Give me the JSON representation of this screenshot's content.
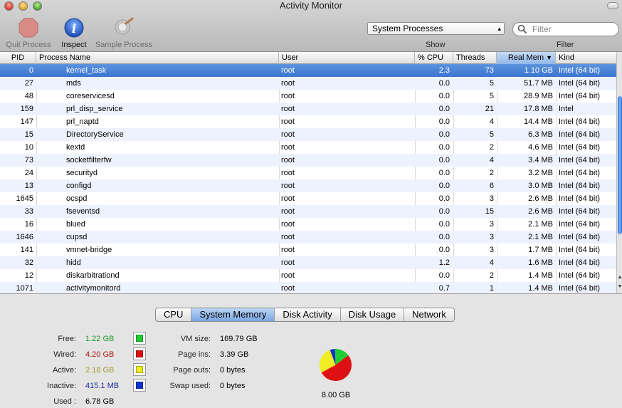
{
  "window": {
    "title": "Activity Monitor"
  },
  "toolbar": {
    "quit_label": "Quit Process",
    "inspect_label": "Inspect",
    "sample_label": "Sample Process",
    "show_label": "Show",
    "filter_label": "Filter",
    "show_value": "System Processes",
    "filter_placeholder": "Filter"
  },
  "table": {
    "columns": [
      "PID",
      "Process Name",
      "User",
      "% CPU",
      "Threads",
      "Real Mem",
      "Kind"
    ],
    "sorted_column": "Real Mem",
    "rows": [
      {
        "pid": "0",
        "name": "kernel_task",
        "user": "root",
        "cpu": "2.3",
        "threads": "73",
        "mem": "1.10 GB",
        "kind": "Intel (64 bit)"
      },
      {
        "pid": "27",
        "name": "mds",
        "user": "root",
        "cpu": "0.0",
        "threads": "5",
        "mem": "51.7 MB",
        "kind": "Intel (64 bit)"
      },
      {
        "pid": "48",
        "name": "coreservicesd",
        "user": "root",
        "cpu": "0.0",
        "threads": "5",
        "mem": "28.9 MB",
        "kind": "Intel (64 bit)"
      },
      {
        "pid": "159",
        "name": "prl_disp_service",
        "user": "root",
        "cpu": "0.0",
        "threads": "21",
        "mem": "17.8 MB",
        "kind": "Intel"
      },
      {
        "pid": "147",
        "name": "prl_naptd",
        "user": "root",
        "cpu": "0.0",
        "threads": "4",
        "mem": "14.4 MB",
        "kind": "Intel (64 bit)"
      },
      {
        "pid": "15",
        "name": "DirectoryService",
        "user": "root",
        "cpu": "0.0",
        "threads": "5",
        "mem": "6.3 MB",
        "kind": "Intel (64 bit)"
      },
      {
        "pid": "10",
        "name": "kextd",
        "user": "root",
        "cpu": "0.0",
        "threads": "2",
        "mem": "4.6 MB",
        "kind": "Intel (64 bit)"
      },
      {
        "pid": "73",
        "name": "socketfilterfw",
        "user": "root",
        "cpu": "0.0",
        "threads": "4",
        "mem": "3.4 MB",
        "kind": "Intel (64 bit)"
      },
      {
        "pid": "24",
        "name": "securityd",
        "user": "root",
        "cpu": "0.0",
        "threads": "2",
        "mem": "3.2 MB",
        "kind": "Intel (64 bit)"
      },
      {
        "pid": "13",
        "name": "configd",
        "user": "root",
        "cpu": "0.0",
        "threads": "6",
        "mem": "3.0 MB",
        "kind": "Intel (64 bit)"
      },
      {
        "pid": "1645",
        "name": "ocspd",
        "user": "root",
        "cpu": "0.0",
        "threads": "3",
        "mem": "2.6 MB",
        "kind": "Intel (64 bit)"
      },
      {
        "pid": "33",
        "name": "fseventsd",
        "user": "root",
        "cpu": "0.0",
        "threads": "15",
        "mem": "2.6 MB",
        "kind": "Intel (64 bit)"
      },
      {
        "pid": "16",
        "name": "blued",
        "user": "root",
        "cpu": "0.0",
        "threads": "3",
        "mem": "2.1 MB",
        "kind": "Intel (64 bit)"
      },
      {
        "pid": "1646",
        "name": "cupsd",
        "user": "root",
        "cpu": "0.0",
        "threads": "3",
        "mem": "2.1 MB",
        "kind": "Intel (64 bit)"
      },
      {
        "pid": "141",
        "name": "vmnet-bridge",
        "user": "root",
        "cpu": "0.0",
        "threads": "3",
        "mem": "1.7 MB",
        "kind": "Intel (64 bit)"
      },
      {
        "pid": "32",
        "name": "hidd",
        "user": "root",
        "cpu": "1.2",
        "threads": "4",
        "mem": "1.6 MB",
        "kind": "Intel (64 bit)"
      },
      {
        "pid": "12",
        "name": "diskarbitrationd",
        "user": "root",
        "cpu": "0.0",
        "threads": "2",
        "mem": "1.4 MB",
        "kind": "Intel (64 bit)"
      },
      {
        "pid": "1071",
        "name": "activitymonitord",
        "user": "root",
        "cpu": "0.7",
        "threads": "1",
        "mem": "1.4 MB",
        "kind": "Intel (64 bit)"
      }
    ]
  },
  "tabs": [
    "CPU",
    "System Memory",
    "Disk Activity",
    "Disk Usage",
    "Network"
  ],
  "active_tab": "System Memory",
  "memory": {
    "free_label": "Free:",
    "free": "1.22 GB",
    "free_gb": 1.22,
    "free_color": "#22cc33",
    "wired_label": "Wired:",
    "wired": "4.20 GB",
    "wired_gb": 4.2,
    "wired_color": "#dd1111",
    "active_label": "Active:",
    "active": "2.18 GB",
    "active_gb": 2.18,
    "active_color": "#eeee22",
    "inactive_label": "Inactive:",
    "inactive": "415.1 MB",
    "inactive_gb": 0.415,
    "inactive_color": "#1133cc",
    "used_label": "Used :",
    "used": "6.78 GB",
    "vm_size_label": "VM size:",
    "vm_size": "169.79 GB",
    "page_ins_label": "Page ins:",
    "page_ins": "3.39 GB",
    "page_outs_label": "Page outs:",
    "page_outs": "0 bytes",
    "swap_used_label": "Swap used:",
    "swap_used": "0 bytes",
    "total": "8.00 GB"
  }
}
